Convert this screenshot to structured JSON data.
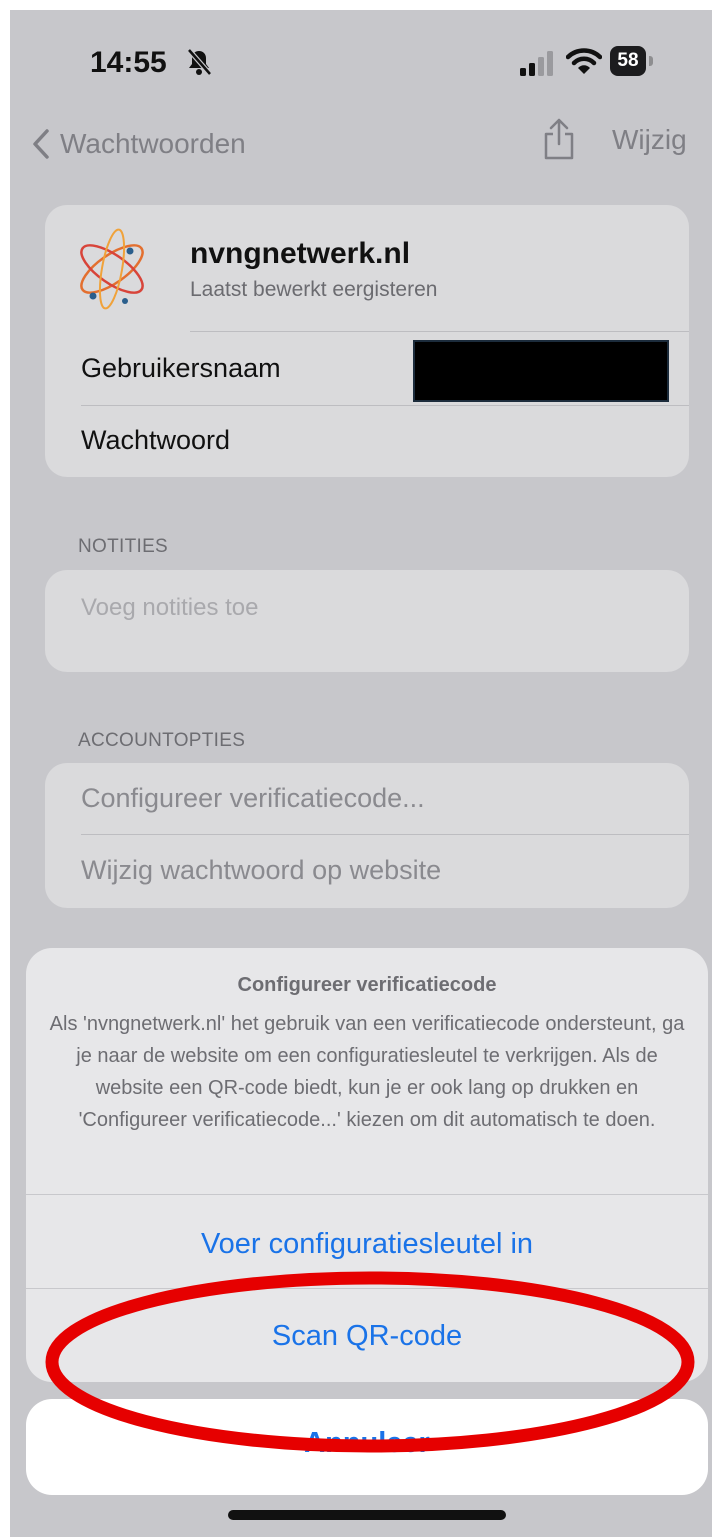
{
  "status": {
    "time": "14:55",
    "battery": "58"
  },
  "nav": {
    "back_label": "Wachtwoorden",
    "edit_label": "Wijzig"
  },
  "account": {
    "site": "nvngnetwerk.nl",
    "subtitle": "Laatst bewerkt eergisteren",
    "username_label": "Gebruikersnaam",
    "password_label": "Wachtwoord"
  },
  "notes": {
    "header": "NOTITIES",
    "placeholder": "Voeg notities toe"
  },
  "options": {
    "header": "ACCOUNTOPTIES",
    "items": [
      "Configureer verificatiecode...",
      "Wijzig wachtwoord op website"
    ]
  },
  "sheet": {
    "title": "Configureer verificatiecode",
    "message": "Als 'nvngnetwerk.nl' het gebruik van een verificatiecode ondersteunt, ga je naar de website om een configuratiesleutel te verkrijgen. Als de website een QR-code biedt, kun je er ook lang op drukken en 'Configureer verificatiecode...' kiezen om dit automatisch te doen.",
    "actions": [
      "Voer configuratiesleutel in",
      "Scan QR-code"
    ],
    "cancel": "Annuleer"
  },
  "colors": {
    "link": "#1a73e8",
    "highlight": "#e60000"
  }
}
